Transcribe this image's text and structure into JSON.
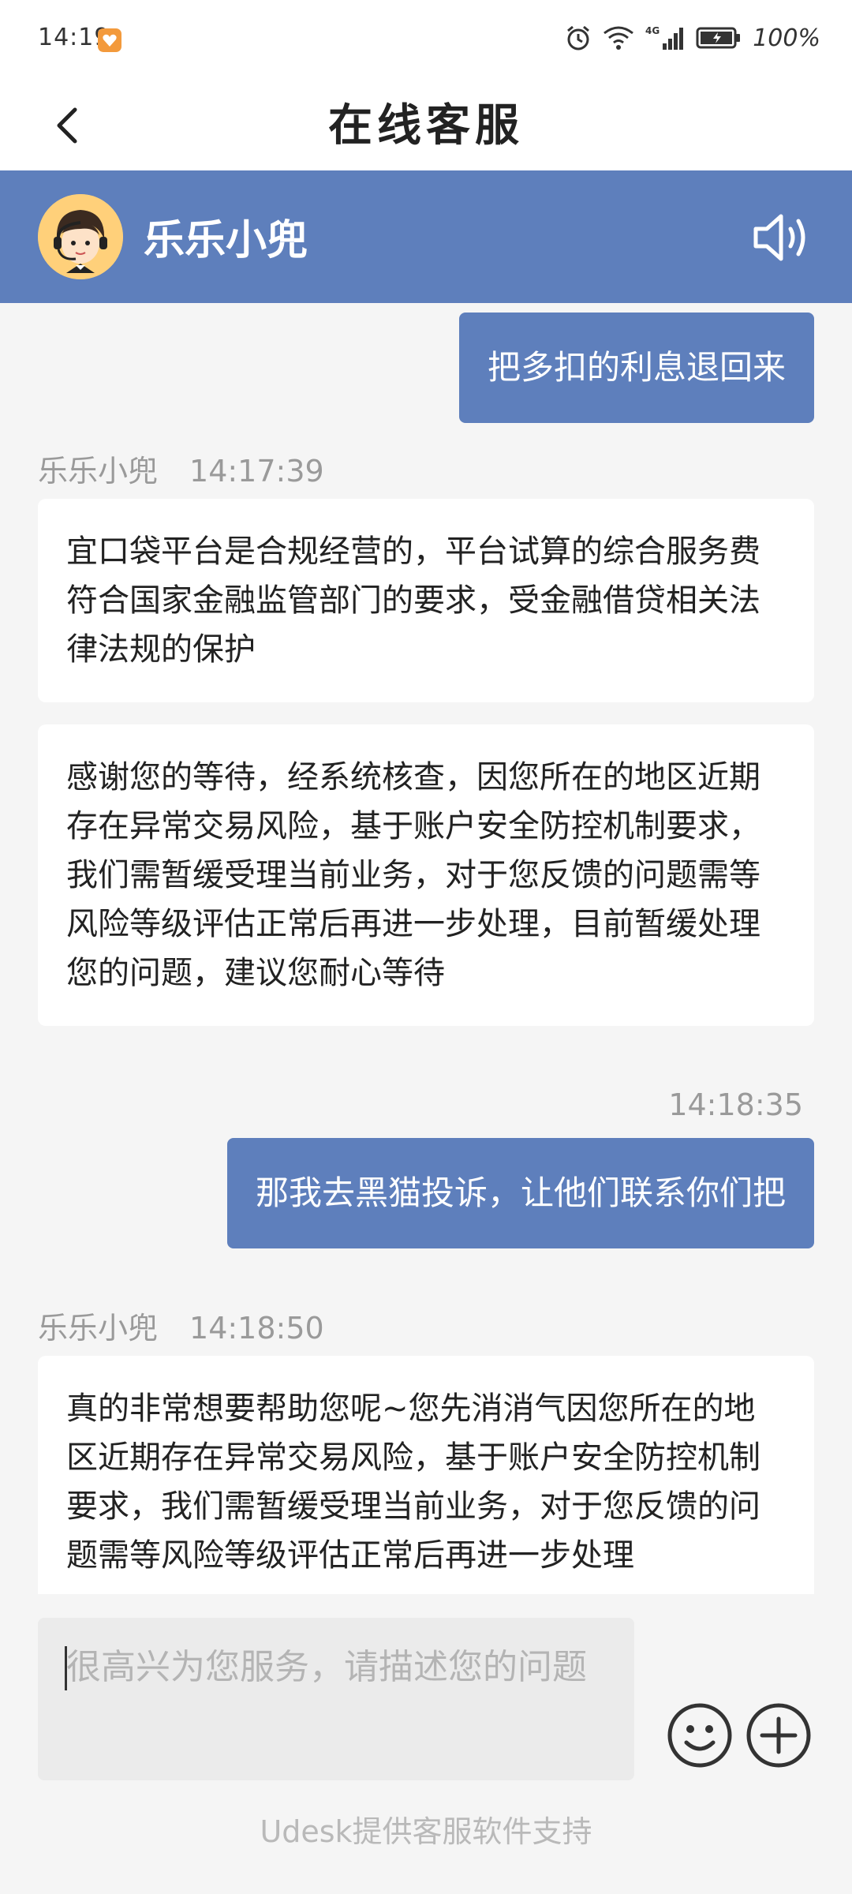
{
  "status_bar": {
    "time": "14:19",
    "battery_text": "100%",
    "network_label": "4G"
  },
  "nav": {
    "title": "在线客服"
  },
  "agent": {
    "name": "乐乐小兜"
  },
  "messages": [
    {
      "type": "user",
      "text": "把多扣的利息退回来"
    },
    {
      "type": "agent_meta",
      "sender": "乐乐小兜",
      "time": "14:17:39"
    },
    {
      "type": "agent",
      "text": "宜口袋平台是合规经营的，平台试算的综合服务费符合国家金融监管部门的要求，受金融借贷相关法律法规的保护"
    },
    {
      "type": "agent",
      "text": "感谢您的等待，经系统核查，因您所在的地区近期存在异常交易风险，基于账户安全防控机制要求，我们需暂缓受理当前业务，对于您反馈的问题需等风险等级评估正常后再进一步处理，目前暂缓处理您的问题，建议您耐心等待"
    },
    {
      "type": "user_meta",
      "time": "14:18:35"
    },
    {
      "type": "user",
      "text": "那我去黑猫投诉，让他们联系你们把"
    },
    {
      "type": "agent_meta",
      "sender": "乐乐小兜",
      "time": "14:18:50"
    },
    {
      "type": "agent",
      "text": "真的非常想要帮助您呢~您先消消气因您所在的地区近期存在异常交易风险，基于账户安全防控机制要求，我们需暂缓受理当前业务，对于您反馈的问题需等风险等级评估正常后再进一步处理"
    }
  ],
  "input": {
    "placeholder": "很高兴为您服务，请描述您的问题"
  },
  "footer": {
    "text": "Udesk提供客服软件支持"
  },
  "icons": {
    "back": "chevron-left-icon",
    "speaker": "speaker-icon",
    "emoji": "smiley-icon",
    "plus": "plus-circle-icon",
    "alarm": "alarm-icon",
    "wifi": "wifi-icon",
    "signal": "signal-icon",
    "battery": "battery-icon"
  },
  "colors": {
    "accent": "#5e7fbc",
    "background": "#f5f5f5",
    "bubble_agent": "#ffffff"
  }
}
